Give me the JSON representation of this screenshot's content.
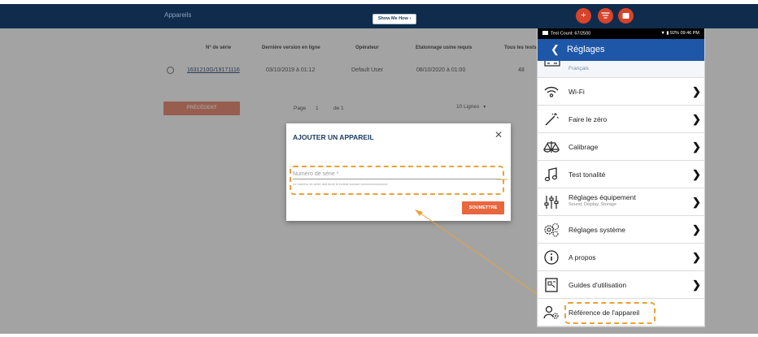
{
  "web_app": {
    "section_title": "Appareils",
    "show_me_how": "Show Me How ›",
    "header_buttons": [
      "plus-icon",
      "filter-icon",
      "menu-icon"
    ],
    "table": {
      "columns": [
        "N° de série",
        "Dernière version en ligne",
        "Opérateur",
        "Etalonnage usine requis",
        "Tous les tests"
      ],
      "rows": [
        {
          "serial": "1631210G/19171116",
          "last_online": "03/10/2019 à 01:12",
          "operator": "Default User",
          "calibration_due": "08/10/2020 à 01:00",
          "tests": "48"
        }
      ]
    },
    "pagination": {
      "previous_label": "PRÉCÉDENT",
      "page_label": "Page",
      "page_number": "1",
      "of_label": "de 1",
      "lines_label": "10 Lignes"
    }
  },
  "modal": {
    "title": "AJOUTER UN APPAREIL",
    "close_icon": "close-icon",
    "field_placeholder": "Numéro de série *",
    "field_hint": "Le numéro de série doit avoir le format suivant xxxxxxxx/xxxxxxxx",
    "submit_label": "SOUMETTRE"
  },
  "phone": {
    "status_left": "Test Count: 67/2500",
    "status_right": "92% 09:46 PM",
    "title": "Réglages",
    "back_icon": "chevron-left-icon",
    "previous_item_text": "Français",
    "menu": [
      {
        "label": "Wi-Fi",
        "sub": "",
        "icon": "wifi-icon",
        "chevron": true
      },
      {
        "label": "Faire le zéro",
        "sub": "",
        "icon": "zero-wand-icon",
        "chevron": true
      },
      {
        "label": "Calibrage",
        "sub": "",
        "icon": "scales-icon",
        "chevron": true
      },
      {
        "label": "Test tonalité",
        "sub": "",
        "icon": "music-note-icon",
        "chevron": true
      },
      {
        "label": "Réglages équipement",
        "sub": "Sound, Display, Storage",
        "icon": "sliders-icon",
        "chevron": true
      },
      {
        "label": "Réglages système",
        "sub": "",
        "icon": "gears-icon",
        "chevron": true
      },
      {
        "label": "A propos",
        "sub": "",
        "icon": "info-icon",
        "chevron": true
      },
      {
        "label": "Guides d'utilisation",
        "sub": "",
        "icon": "guide-icon",
        "chevron": true
      },
      {
        "label": "Référence de l'appareil",
        "sub": "",
        "icon": "user-gear-icon",
        "chevron": false
      }
    ]
  },
  "colors": {
    "navy_header": "#0f2c4c",
    "phone_appbar": "#1f57a8",
    "accent_orange": "#e8673f",
    "highlight_dash": "#e8a33a"
  }
}
